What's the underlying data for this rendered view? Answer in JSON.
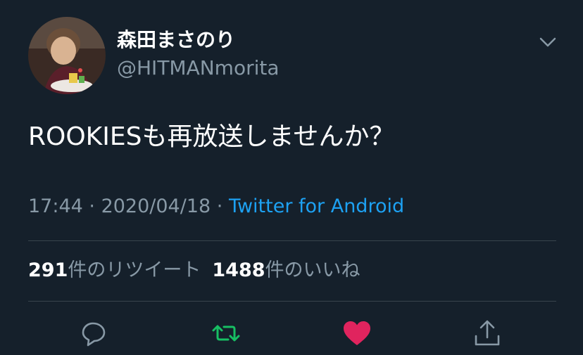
{
  "user": {
    "display_name": "森田まさのり",
    "handle": "@HITMANmorita"
  },
  "tweet": {
    "text": "ROOKIESも再放送しませんか？",
    "time": "17:44",
    "separator": " · ",
    "date": "2020/04/18",
    "source": "Twitter for Android"
  },
  "stats": {
    "retweet_count": "291",
    "retweet_label": "件のリツイート",
    "like_count": "1488",
    "like_label": "件のいいね"
  },
  "actions": {
    "reply_icon": "speech-bubble-icon",
    "retweet_icon": "retweet-arrows-icon",
    "like_icon": "heart-icon",
    "share_icon": "share-arrow-icon"
  },
  "colors": {
    "background": "#15202b",
    "secondary_text": "#8899a6",
    "link": "#1da1f2",
    "retweet_active": "#17bf63",
    "like_active": "#e0245e",
    "divider": "#38444d"
  }
}
